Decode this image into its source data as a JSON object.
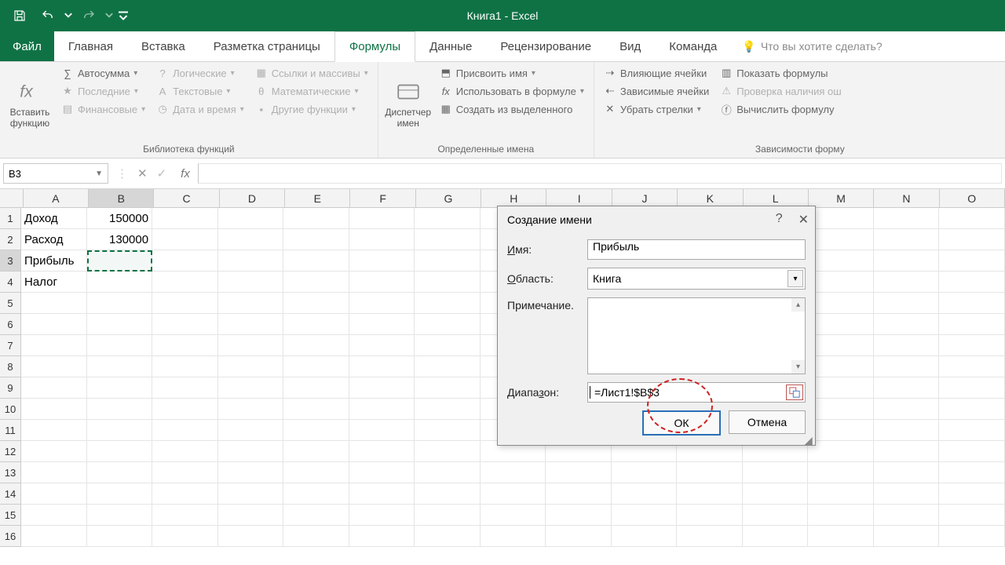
{
  "title": "Книга1 - Excel",
  "tabs": {
    "file": "Файл",
    "home": "Главная",
    "insert": "Вставка",
    "layout": "Разметка страницы",
    "formulas": "Формулы",
    "data": "Данные",
    "review": "Рецензирование",
    "view": "Вид",
    "team": "Команда"
  },
  "tellme": "Что вы хотите сделать?",
  "ribbon": {
    "insert_fn": "Вставить функцию",
    "lib_group": "Библиотека функций",
    "autosum": "Автосумма",
    "recent": "Последние",
    "financial": "Финансовые",
    "logical": "Логические",
    "text": "Текстовые",
    "datetime": "Дата и время",
    "lookup": "Ссылки и массивы",
    "math": "Математические",
    "more": "Другие функции",
    "name_mgr": "Диспетчер имен",
    "names_group": "Определенные имена",
    "define": "Присвоить имя",
    "usein": "Использовать в формуле",
    "createfrom": "Создать из выделенного",
    "trace_p": "Влияющие ячейки",
    "trace_d": "Зависимые ячейки",
    "remove_a": "Убрать стрелки",
    "show_f": "Показать формулы",
    "err_chk": "Проверка наличия ош",
    "eval": "Вычислить формулу",
    "audit_group": "Зависимости форму"
  },
  "namebox": "B3",
  "cols": [
    "A",
    "B",
    "C",
    "D",
    "E",
    "F",
    "G",
    "H",
    "I",
    "J",
    "K",
    "L",
    "M",
    "N",
    "O"
  ],
  "rows": [
    "1",
    "2",
    "3",
    "4",
    "5",
    "6",
    "7",
    "8",
    "9",
    "10",
    "11",
    "12",
    "13",
    "14",
    "15",
    "16"
  ],
  "cells": {
    "A1": "Доход",
    "B1": "150000",
    "A2": "Расход",
    "B2": "130000",
    "A3": "Прибыль",
    "A4": "Налог"
  },
  "dialog": {
    "title": "Создание имени",
    "name_l": "Имя:",
    "name_v": "Прибыль",
    "scope_l": "Область:",
    "scope_v": "Книга",
    "comment_l": "Примечание.",
    "range_l": "Диапазон:",
    "range_v": "=Лист1!$B$3",
    "ok": "ОК",
    "cancel": "Отмена"
  }
}
